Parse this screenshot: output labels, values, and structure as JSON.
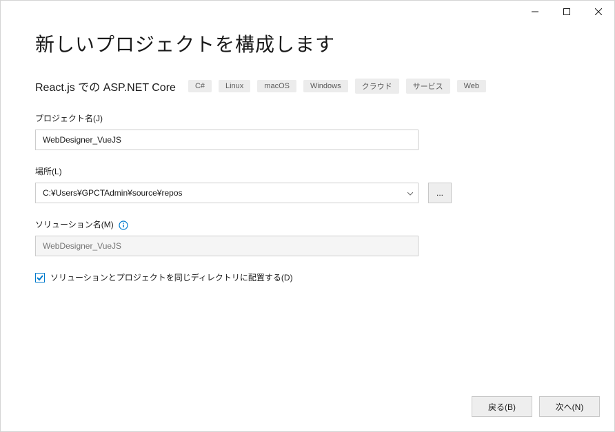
{
  "titlebar": {
    "minimize": "minimize",
    "maximize": "maximize",
    "close": "close"
  },
  "page": {
    "title": "新しいプロジェクトを構成します"
  },
  "template": {
    "name": "React.js での ASP.NET Core",
    "tags": [
      "C#",
      "Linux",
      "macOS",
      "Windows",
      "クラウド",
      "サービス",
      "Web"
    ]
  },
  "fields": {
    "projectName": {
      "label": "プロジェクト名(J)",
      "value": "WebDesigner_VueJS"
    },
    "location": {
      "label": "場所(L)",
      "value": "C:¥Users¥GPCTAdmin¥source¥repos",
      "browseLabel": "..."
    },
    "solutionName": {
      "label": "ソリューション名(M)",
      "placeholder": "WebDesigner_VueJS"
    },
    "sameDirectory": {
      "label": "ソリューションとプロジェクトを同じディレクトリに配置する(D)",
      "checked": true
    }
  },
  "footer": {
    "back": "戻る(B)",
    "next": "次へ(N)"
  }
}
